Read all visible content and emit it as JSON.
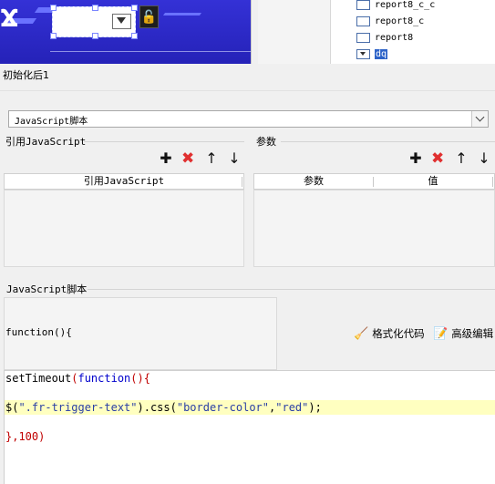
{
  "tree": {
    "items": [
      {
        "label": "report8_c_c",
        "selected": false
      },
      {
        "label": "report8_c",
        "selected": false
      },
      {
        "label": "report8",
        "selected": false
      },
      {
        "label": "dq",
        "selected": true
      }
    ]
  },
  "event": {
    "title": "初始化后1"
  },
  "action_type": {
    "selected": "JavaScript脚本"
  },
  "ref_js": {
    "section_label": "引用JavaScript",
    "column_header": "引用JavaScript",
    "toolbar": {
      "add_icon": "plus-icon",
      "delete_icon": "delete-x-icon",
      "up_icon": "arrow-up-icon",
      "down_icon": "arrow-down-icon"
    }
  },
  "params": {
    "section_label": "参数",
    "columns": [
      "参数",
      "值"
    ]
  },
  "script": {
    "section_label": "JavaScript脚本",
    "function_header": "function(){",
    "format_label": "格式化代码",
    "advanced_label": "高级编辑",
    "code_lines": [
      [
        {
          "t": "setTimeout",
          "c": ""
        },
        {
          "t": "(",
          "c": "paren"
        },
        {
          "t": "function",
          "c": "kw"
        },
        {
          "t": "(){",
          "c": "paren"
        }
      ],
      [],
      [
        {
          "t": "$(",
          "c": ""
        },
        {
          "t": "\".fr-trigger-text\"",
          "c": "str"
        },
        {
          "t": ").css(",
          "c": ""
        },
        {
          "t": "\"border-color\"",
          "c": "str"
        },
        {
          "t": ",",
          "c": ""
        },
        {
          "t": "\"red\"",
          "c": "str"
        },
        {
          "t": ");",
          "c": ""
        }
      ],
      [],
      [
        {
          "t": "},",
          "c": "paren"
        },
        {
          "t": "100",
          "c": "num"
        },
        {
          "t": ")",
          "c": "paren"
        }
      ]
    ],
    "highlighted_line": 2
  },
  "colors": {
    "canvas_bg": "#2826c4",
    "selection": "#2d63c8",
    "delete_red": "#e03030",
    "keyword": "#0000cc",
    "highlight": "#ffffc0"
  }
}
